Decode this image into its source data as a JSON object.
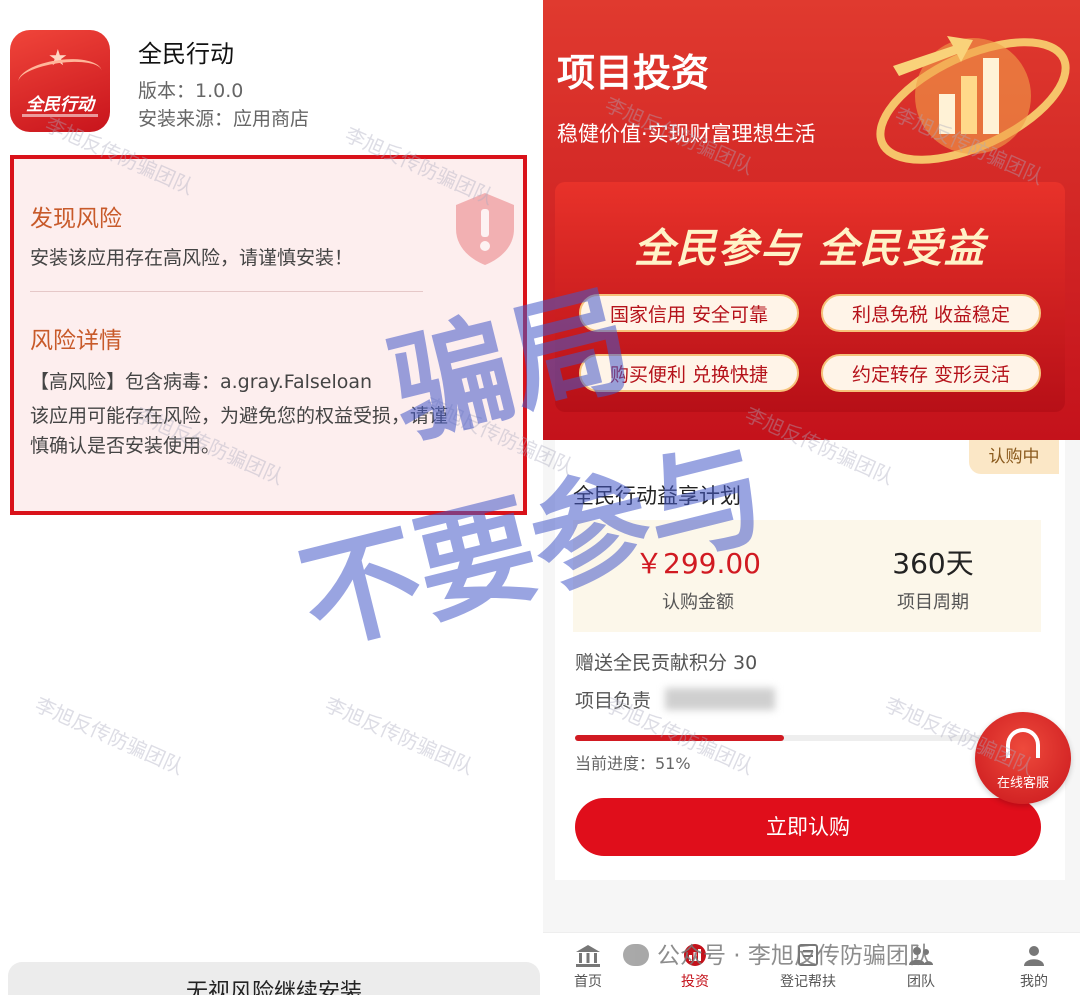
{
  "left_panel": {
    "app": {
      "icon_text": "全民行动",
      "name": "全民行动",
      "version": "版本：1.0.0",
      "source": "安装来源：应用商店"
    },
    "risk": {
      "title": "发现风险",
      "description": "安装该应用存在高风险，请谨慎安装！",
      "detail_title": "风险详情",
      "virus_line": "【高风险】包含病毒：a.gray.Falseloan",
      "detail_line1": "该应用可能存在风险，为避免您的权益受损，请谨",
      "detail_line2": "慎确认是否安装使用。"
    },
    "ignore_button": "无视风险继续安装"
  },
  "overlay_warning": {
    "line1": "骗局",
    "line2": "不要参与"
  },
  "watermark": "李旭反传防骗团队",
  "right_panel": {
    "hero": {
      "title": "项目投资",
      "subtitle": "稳健价值·实现财富理想生活"
    },
    "banner": {
      "slogan": "全民参与 全民受益",
      "features": [
        "国家信用 安全可靠",
        "利息免税 收益稳定",
        "购买便利 兑换快捷",
        "约定转存 变形灵活"
      ]
    },
    "plan": {
      "badge": "认购中",
      "title": "全民行动益享计划",
      "amount": "￥299.00",
      "amount_label": "认购金额",
      "period": "360天",
      "period_label": "项目周期",
      "points": "赠送全民贡献积分 30",
      "manager_label": "项目负责",
      "progress_label": "当前进度：51%",
      "progress": 0.51,
      "cta": "立即认购"
    },
    "customer_service": "在线客服",
    "tabs": [
      {
        "label": "首页",
        "icon": "bank-icon"
      },
      {
        "label": "投资",
        "icon": "chart-icon"
      },
      {
        "label": "登记帮扶",
        "icon": "register-icon"
      },
      {
        "label": "团队",
        "icon": "team-icon"
      },
      {
        "label": "我的",
        "icon": "user-icon"
      }
    ],
    "wechat_credit": "公众号 · 李旭反传防骗团队"
  },
  "colors": {
    "brand_red": "#d11a22",
    "risk_border": "#d9121a",
    "risk_heading": "#c85a2a",
    "badge_bg": "#fbe7c6",
    "warning_overlay": "#4a5ac8"
  }
}
